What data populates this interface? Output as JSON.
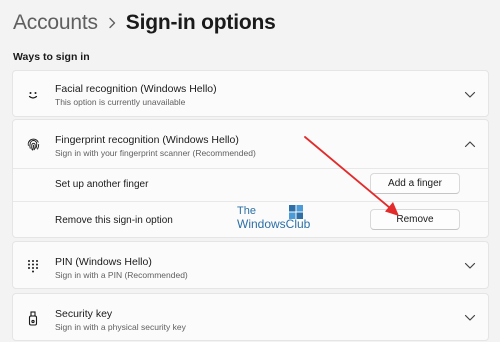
{
  "breadcrumb": {
    "root": "Accounts",
    "current": "Sign-in options"
  },
  "section": {
    "title": "Ways to sign in"
  },
  "options": {
    "facial": {
      "title": "Facial recognition (Windows Hello)",
      "subtitle": "This option is currently unavailable",
      "icon": "face-icon",
      "state": "collapsed"
    },
    "fingerprint": {
      "title": "Fingerprint recognition (Windows Hello)",
      "subtitle": "Sign in with your fingerprint scanner (Recommended)",
      "icon": "fingerprint-icon",
      "state": "expanded",
      "rows": {
        "setup": {
          "label": "Set up another finger",
          "button": "Add a finger"
        },
        "remove": {
          "label": "Remove this sign-in option",
          "button": "Remove"
        }
      }
    },
    "pin": {
      "title": "PIN (Windows Hello)",
      "subtitle": "Sign in with a PIN (Recommended)",
      "icon": "keypad-icon",
      "state": "collapsed"
    },
    "security_key": {
      "title": "Security key",
      "subtitle": "Sign in with a physical security key",
      "icon": "usb-key-icon",
      "state": "collapsed"
    }
  },
  "watermark": {
    "line1": "The",
    "line2": "WindowsClub"
  },
  "annotation_color": "#e32b2b"
}
